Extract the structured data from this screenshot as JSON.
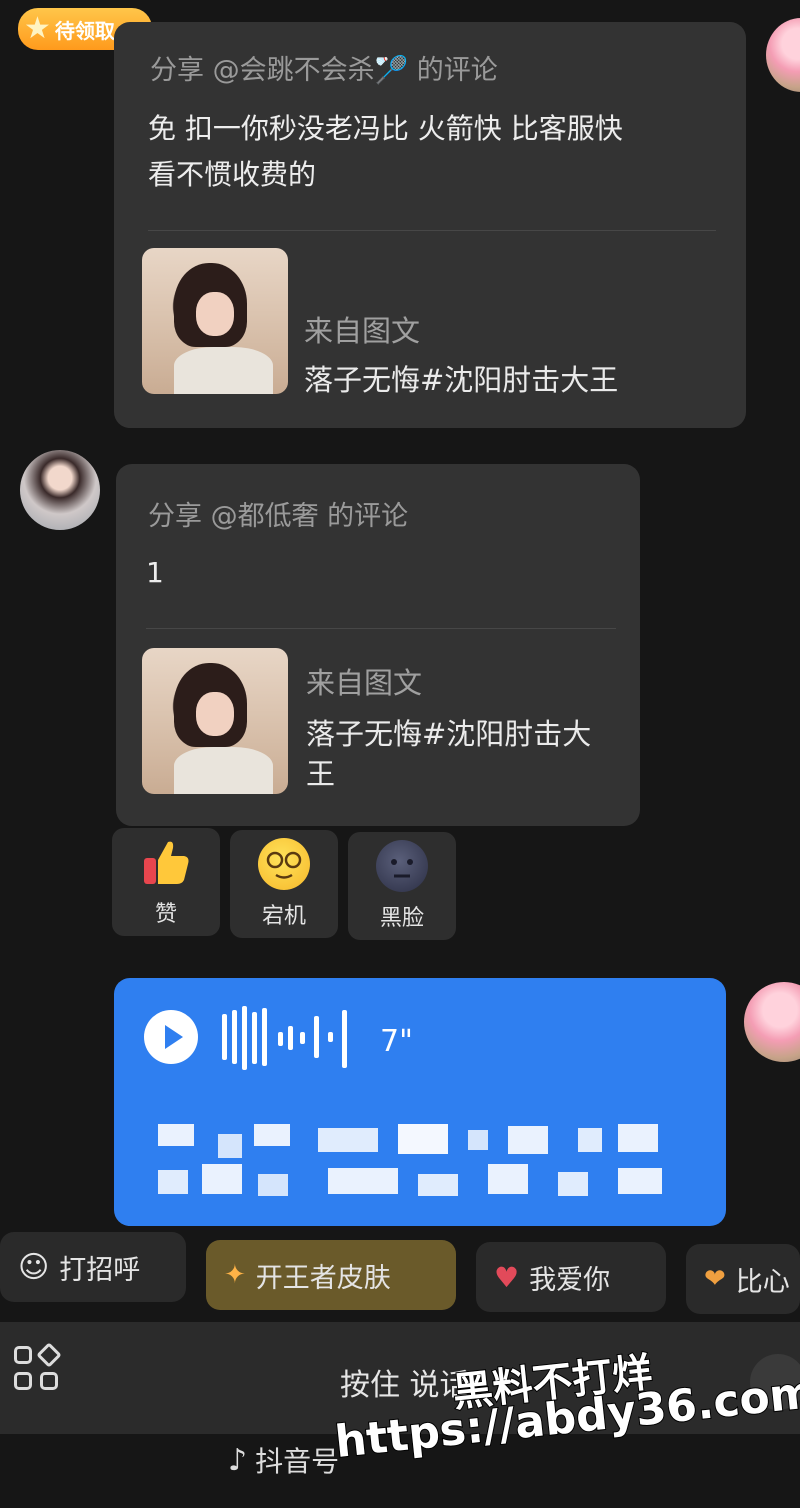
{
  "badge": {
    "label": "待领取"
  },
  "message1": {
    "share_title": "分享 @会跳不会杀🏸 的评论",
    "body_line1": "免  扣一你秒没老冯比 火箭快 比客服快",
    "body_line2": "看不惯收费的",
    "source_label": "来自图文",
    "source_title": "落子无悔#沈阳肘击大王"
  },
  "message2": {
    "share_title": "分享 @都低奢 的评论",
    "body": "1",
    "source_label": "来自图文",
    "source_title_line1": "落子无悔#沈阳肘击大",
    "source_title_line2": "王"
  },
  "reactions": [
    {
      "icon": "thumbs-up-icon",
      "label": "赞"
    },
    {
      "icon": "dizzy-face-icon",
      "label": "宕机"
    },
    {
      "icon": "black-face-icon",
      "label": "黑脸"
    }
  ],
  "voice_message": {
    "duration": "7\""
  },
  "quick_chips": [
    {
      "label": "打招呼"
    },
    {
      "label": "开王者皮肤"
    },
    {
      "label": "我爱你"
    },
    {
      "label": "比心"
    }
  ],
  "input_bar": {
    "hold_to_talk": "按住 说话"
  },
  "footer": {
    "douyin_id": "抖音号"
  },
  "watermark": {
    "line1": "黑料不打烊",
    "line2": "https://abdy36.com"
  }
}
